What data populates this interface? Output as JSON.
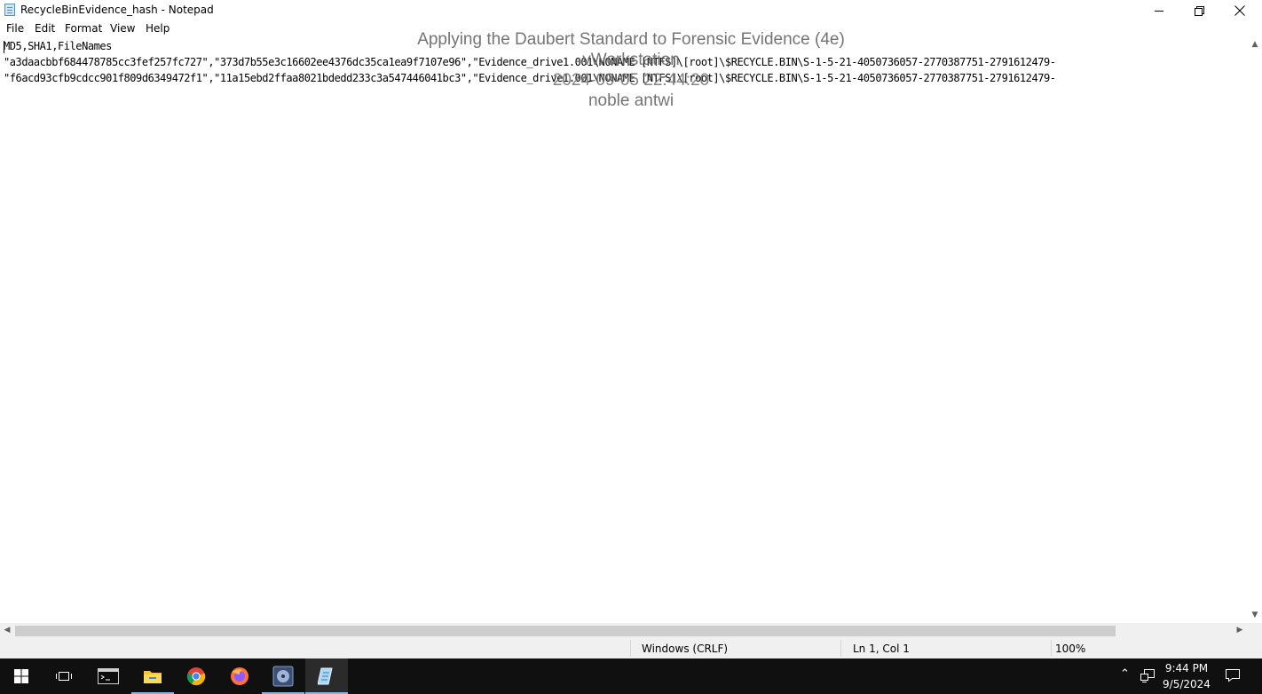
{
  "window": {
    "title": "RecycleBinEvidence_hash - Notepad",
    "icon": "notepad-icon"
  },
  "menu": [
    "File",
    "Edit",
    "Format",
    "View",
    "Help"
  ],
  "editor": {
    "lines": [
      "MD5,SHA1,FileNames",
      "\"a3daacbbf684478785cc3fef257fc727\",\"373d7b55e3c16602ee4376dc35ca1ea9f7107e96\",\"Evidence_drive1.001\\NONAME [NTFS]\\[root]\\$RECYCLE.BIN\\S-1-5-21-4050736057-2770387751-2791612479-",
      "\"f6acd93cfb9cdcc901f809d6349472f1\",\"11a15ebd2ffaa8021bdedd233c3a547446041bc3\",\"Evidence_drive1.001\\NONAME [NTFS]\\[root]\\$RECYCLE.BIN\\S-1-5-21-4050736057-2770387751-2791612479-"
    ]
  },
  "watermark": {
    "line1": "Applying the Daubert Standard to Forensic Evidence (4e)",
    "line2": "vWorkstation",
    "line3": "2024-09-05 22:44:20",
    "line4": "noble antwi"
  },
  "status": {
    "line_ending": "Windows (CRLF)",
    "position": "Ln 1, Col 1",
    "zoom": "100%"
  },
  "taskbar": {
    "time": "9:44 PM",
    "date": "9/5/2024",
    "apps": [
      "start-button",
      "task-view",
      "terminal",
      "file-explorer",
      "chrome",
      "firefox",
      "ftk-imager",
      "notepad"
    ]
  },
  "colors": {
    "taskbar_bg": "#101010",
    "accent": "#76b9ed",
    "status_bg": "#f0f0f0"
  }
}
